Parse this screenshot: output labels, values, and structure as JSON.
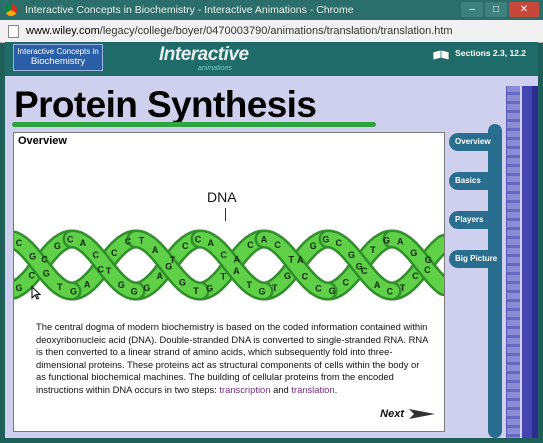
{
  "browser": {
    "window_title": "Interactive Concepts in Biochemistry - Interactive Animations - Chrome",
    "url_host": "www.wiley.com",
    "url_path": "/legacy/college/boyer/0470003790/animations/translation/translation.htm"
  },
  "header": {
    "brand_line1": "Interactive Concepts in",
    "brand_line2": "Biochemistry",
    "logo_main": "Interactive",
    "logo_sub": "animations",
    "sections": "Sections 2.3, 12.2"
  },
  "page": {
    "title": "Protein Synthesis",
    "section_heading": "Overview",
    "diagram_label": "DNA",
    "paragraph_pre": "The central dogma of modern biochemistry is based on the coded information contained within deoxyribonucleic acid (DNA).  Double-stranded DNA is converted to single-stranded RNA.  RNA is then converted to a linear strand of amino acids, which subsequently fold into three-dimensional proteins.  These proteins act as structural components of cells within the body or as functional biochemical machines.  The building of cellular proteins from the encoded instructions within DNA occurs in two steps: ",
    "link_transcription": "transcription",
    "paragraph_mid": " and ",
    "link_translation": "translation",
    "paragraph_end": ".",
    "next_label": "Next"
  },
  "nav": {
    "items": [
      {
        "label": "Overview"
      },
      {
        "label": "Basics"
      },
      {
        "label": "Players"
      },
      {
        "label": "Big Picture"
      }
    ]
  },
  "dna": {
    "upper_strand": "CGGTGACCCTAGGTGTACACTCCGCGTGAGC",
    "lower_strand": "GCCGCACTGGGATCCACATGTGAGGCGCACTCG"
  },
  "colors": {
    "strand_light": "#5fd048",
    "strand_dark": "#2f8f2a",
    "accent_green": "#2ea340",
    "nav_blue": "#2a6e8f",
    "link_purple": "#7a2d86"
  }
}
